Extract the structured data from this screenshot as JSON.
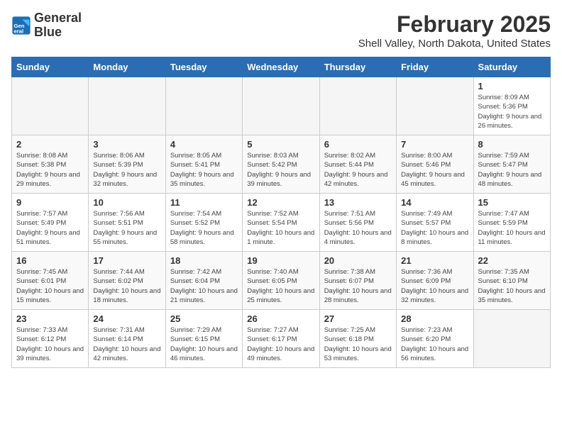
{
  "logo": {
    "line1": "General",
    "line2": "Blue"
  },
  "title": "February 2025",
  "subtitle": "Shell Valley, North Dakota, United States",
  "days_header": [
    "Sunday",
    "Monday",
    "Tuesday",
    "Wednesday",
    "Thursday",
    "Friday",
    "Saturday"
  ],
  "weeks": [
    [
      {
        "day": "",
        "info": ""
      },
      {
        "day": "",
        "info": ""
      },
      {
        "day": "",
        "info": ""
      },
      {
        "day": "",
        "info": ""
      },
      {
        "day": "",
        "info": ""
      },
      {
        "day": "",
        "info": ""
      },
      {
        "day": "1",
        "info": "Sunrise: 8:09 AM\nSunset: 5:36 PM\nDaylight: 9 hours and 26 minutes."
      }
    ],
    [
      {
        "day": "2",
        "info": "Sunrise: 8:08 AM\nSunset: 5:38 PM\nDaylight: 9 hours and 29 minutes."
      },
      {
        "day": "3",
        "info": "Sunrise: 8:06 AM\nSunset: 5:39 PM\nDaylight: 9 hours and 32 minutes."
      },
      {
        "day": "4",
        "info": "Sunrise: 8:05 AM\nSunset: 5:41 PM\nDaylight: 9 hours and 35 minutes."
      },
      {
        "day": "5",
        "info": "Sunrise: 8:03 AM\nSunset: 5:42 PM\nDaylight: 9 hours and 39 minutes."
      },
      {
        "day": "6",
        "info": "Sunrise: 8:02 AM\nSunset: 5:44 PM\nDaylight: 9 hours and 42 minutes."
      },
      {
        "day": "7",
        "info": "Sunrise: 8:00 AM\nSunset: 5:46 PM\nDaylight: 9 hours and 45 minutes."
      },
      {
        "day": "8",
        "info": "Sunrise: 7:59 AM\nSunset: 5:47 PM\nDaylight: 9 hours and 48 minutes."
      }
    ],
    [
      {
        "day": "9",
        "info": "Sunrise: 7:57 AM\nSunset: 5:49 PM\nDaylight: 9 hours and 51 minutes."
      },
      {
        "day": "10",
        "info": "Sunrise: 7:56 AM\nSunset: 5:51 PM\nDaylight: 9 hours and 55 minutes."
      },
      {
        "day": "11",
        "info": "Sunrise: 7:54 AM\nSunset: 5:52 PM\nDaylight: 9 hours and 58 minutes."
      },
      {
        "day": "12",
        "info": "Sunrise: 7:52 AM\nSunset: 5:54 PM\nDaylight: 10 hours and 1 minute."
      },
      {
        "day": "13",
        "info": "Sunrise: 7:51 AM\nSunset: 5:56 PM\nDaylight: 10 hours and 4 minutes."
      },
      {
        "day": "14",
        "info": "Sunrise: 7:49 AM\nSunset: 5:57 PM\nDaylight: 10 hours and 8 minutes."
      },
      {
        "day": "15",
        "info": "Sunrise: 7:47 AM\nSunset: 5:59 PM\nDaylight: 10 hours and 11 minutes."
      }
    ],
    [
      {
        "day": "16",
        "info": "Sunrise: 7:45 AM\nSunset: 6:01 PM\nDaylight: 10 hours and 15 minutes."
      },
      {
        "day": "17",
        "info": "Sunrise: 7:44 AM\nSunset: 6:02 PM\nDaylight: 10 hours and 18 minutes."
      },
      {
        "day": "18",
        "info": "Sunrise: 7:42 AM\nSunset: 6:04 PM\nDaylight: 10 hours and 21 minutes."
      },
      {
        "day": "19",
        "info": "Sunrise: 7:40 AM\nSunset: 6:05 PM\nDaylight: 10 hours and 25 minutes."
      },
      {
        "day": "20",
        "info": "Sunrise: 7:38 AM\nSunset: 6:07 PM\nDaylight: 10 hours and 28 minutes."
      },
      {
        "day": "21",
        "info": "Sunrise: 7:36 AM\nSunset: 6:09 PM\nDaylight: 10 hours and 32 minutes."
      },
      {
        "day": "22",
        "info": "Sunrise: 7:35 AM\nSunset: 6:10 PM\nDaylight: 10 hours and 35 minutes."
      }
    ],
    [
      {
        "day": "23",
        "info": "Sunrise: 7:33 AM\nSunset: 6:12 PM\nDaylight: 10 hours and 39 minutes."
      },
      {
        "day": "24",
        "info": "Sunrise: 7:31 AM\nSunset: 6:14 PM\nDaylight: 10 hours and 42 minutes."
      },
      {
        "day": "25",
        "info": "Sunrise: 7:29 AM\nSunset: 6:15 PM\nDaylight: 10 hours and 46 minutes."
      },
      {
        "day": "26",
        "info": "Sunrise: 7:27 AM\nSunset: 6:17 PM\nDaylight: 10 hours and 49 minutes."
      },
      {
        "day": "27",
        "info": "Sunrise: 7:25 AM\nSunset: 6:18 PM\nDaylight: 10 hours and 53 minutes."
      },
      {
        "day": "28",
        "info": "Sunrise: 7:23 AM\nSunset: 6:20 PM\nDaylight: 10 hours and 56 minutes."
      },
      {
        "day": "",
        "info": ""
      }
    ]
  ]
}
